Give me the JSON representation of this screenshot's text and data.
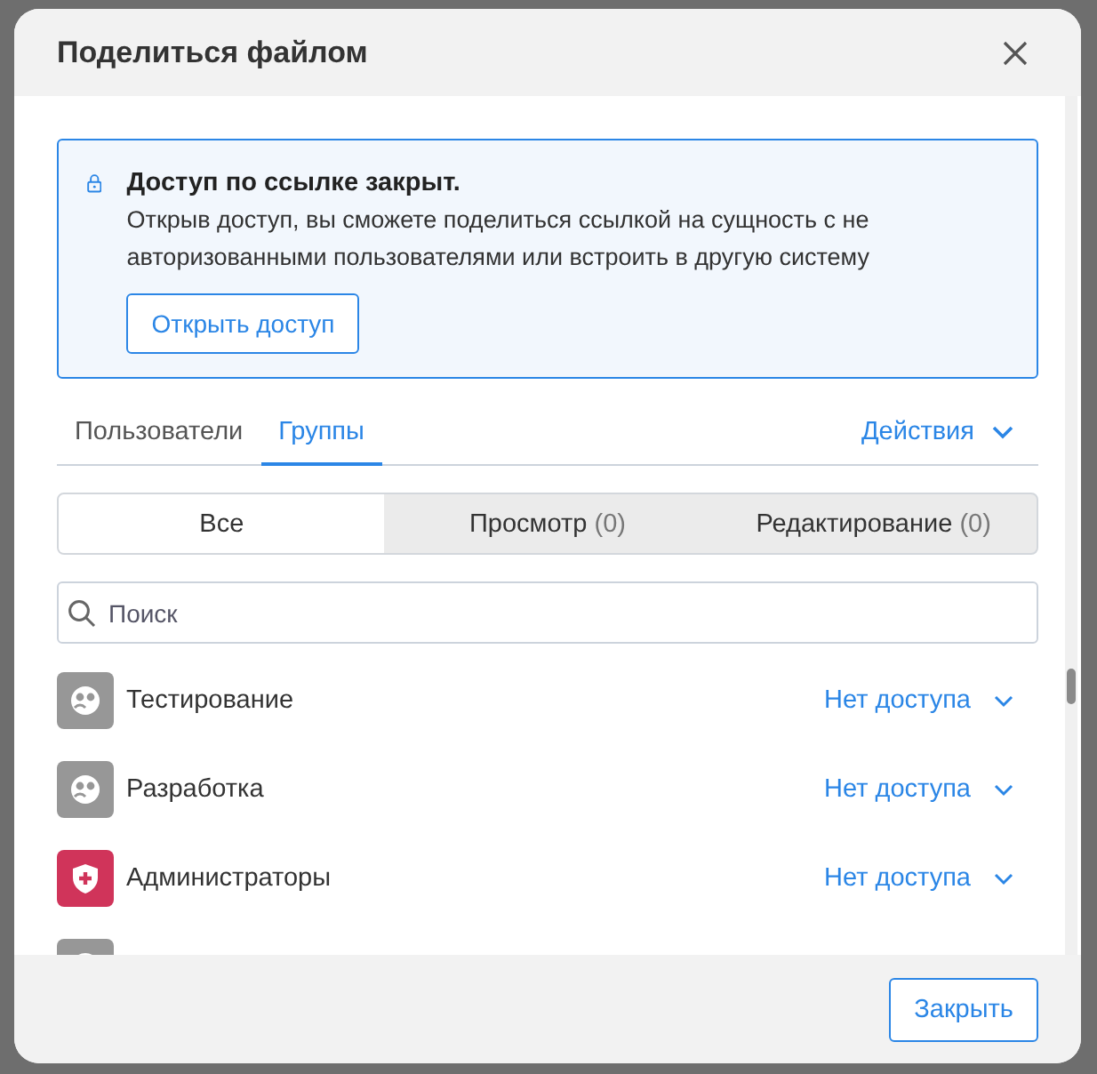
{
  "dialog": {
    "title": "Поделиться файлом"
  },
  "notice": {
    "title": "Доступ по ссылке закрыт.",
    "text": "Открыв доступ, вы сможете поделиться ссылкой на сущность с не авторизованными пользователями или встроить в другую систему",
    "button": "Открыть доступ"
  },
  "tabs": [
    {
      "label": "Пользователи",
      "selected": false
    },
    {
      "label": "Группы",
      "selected": true
    }
  ],
  "actions": "Действия",
  "filters": [
    {
      "label": "Все",
      "selected": true
    },
    {
      "label": "Просмотр",
      "count": "(0)",
      "selected": false
    },
    {
      "label": "Редактирование",
      "count": "(0)",
      "selected": false
    }
  ],
  "search": {
    "placeholder": "Поиск"
  },
  "groups": [
    {
      "kind": "group",
      "name": "Тестирование",
      "access": "Нет доступа"
    },
    {
      "kind": "group",
      "name": "Разработка",
      "access": "Нет доступа"
    },
    {
      "kind": "admin",
      "name": "Администраторы",
      "access": "Нет доступа"
    },
    {
      "kind": "group"
    }
  ],
  "buttons": [
    "Закрыть"
  ]
}
